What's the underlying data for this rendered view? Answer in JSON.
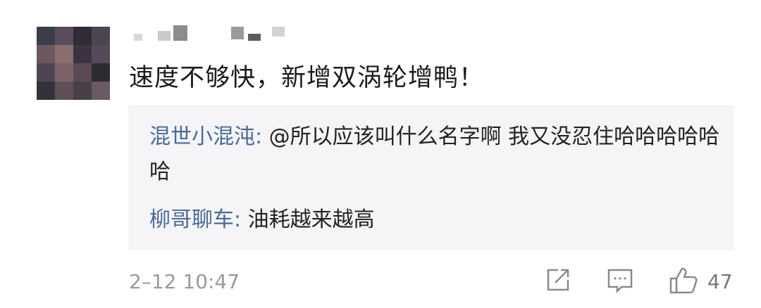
{
  "comment": {
    "text": "速度不够快，新增双涡轮增鸭！",
    "timestamp": "2–12 10:47",
    "like_count": "47"
  },
  "replies": [
    {
      "author": "混世小混沌:",
      "text": " @所以应该叫什么名字啊 我又没忍住哈哈哈哈哈哈"
    },
    {
      "author": "柳哥聊车:",
      "text": " 油耗越来越高"
    }
  ],
  "icons": {
    "share": "share-icon",
    "comment": "comment-icon",
    "like": "thumbs-up-icon"
  },
  "colors": {
    "author_link": "#4a6a99",
    "reply_bg": "#f5f5f7",
    "meta_text": "#9a9a9a"
  }
}
